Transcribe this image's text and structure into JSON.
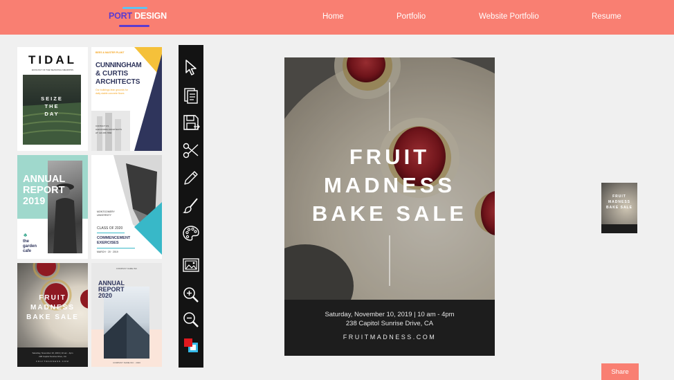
{
  "logo": {
    "part1": "PORT",
    "part2": "DESIGN"
  },
  "nav": {
    "links": [
      "Home",
      "Portfolio",
      "Website Portfolio",
      "Resume"
    ]
  },
  "templates": {
    "tidal": {
      "title": "TIDAL",
      "subtitle": "ECOLOGY OF THE SEASONAL MEADOWS",
      "l1": "SEIZE",
      "l2": "THE",
      "l3": "DAY"
    },
    "architects": {
      "tag": "BEES & MASTER PLANT",
      "l1": "CUNNINGHAM",
      "l2": "& CURTIS",
      "l3": "ARCHITECTS",
      "sub1": "Our buildings lean grounds for",
      "sub2": "daily stable concrete floors",
      "c1": "CONTACT US",
      "c2": "ALEXANDRA ARCHITECTS",
      "c3": "AT: 123 456 7890"
    },
    "annual2019": {
      "l1": "ANNUAL",
      "l2": "REPORT",
      "l3": "2019",
      "brand1": "the",
      "brand2": "garden",
      "brand3": "cafe"
    },
    "commencement": {
      "uni1": "MONTGOMERY",
      "uni2": "UNIVERSITY",
      "class": "CLASS OF 2020",
      "l1": "COMMENCEMENT",
      "l2": "EXERCISES",
      "date": "MARCH · 20 · 2019"
    },
    "fruit": {
      "l1": "FRUIT",
      "l2": "MADNESS",
      "l3": "BAKE SALE",
      "date": "Saturday, November 10, 2019 | 10 am - 4pm",
      "addr": "238 Capitol Sunrise Drive, CA",
      "url": "FRUITMADNESS.COM"
    },
    "annual2020": {
      "top": "COMPANY NAME INC",
      "l1": "ANNUAL",
      "l2": "REPORT",
      "l3": "2020",
      "bottom": "COMPANY NAME INC · 2020"
    }
  },
  "poster": {
    "line1": "FRUIT",
    "line2": "MADNESS",
    "line3": "BAKE SALE",
    "date": "Saturday, November 10, 2019 | 10 am - 4pm",
    "address": "238 Capitol Sunrise Drive,  CA",
    "website": "FRUITMADNESS.COM"
  },
  "preview": {
    "line1": "FRUIT",
    "line2": "MADNESS",
    "line3": "BAKE SALE"
  },
  "share_label": "Share",
  "tools": [
    "select-arrow-icon",
    "document-icon",
    "save-icon",
    "scissors-icon",
    "pencil-icon",
    "brush-icon",
    "palette-icon",
    "image-icon",
    "zoom-in-icon",
    "zoom-out-icon",
    "color-swatch-icon"
  ],
  "colors": {
    "accent": "#f97f72",
    "logo_primary": "#5a3bd0",
    "toolbar": "#131313",
    "swatch_front": "#e0191f",
    "swatch_back": "#35b9e8",
    "teal": "#38b8c8",
    "navy": "#2f355c",
    "yellow": "#f5c13a"
  }
}
